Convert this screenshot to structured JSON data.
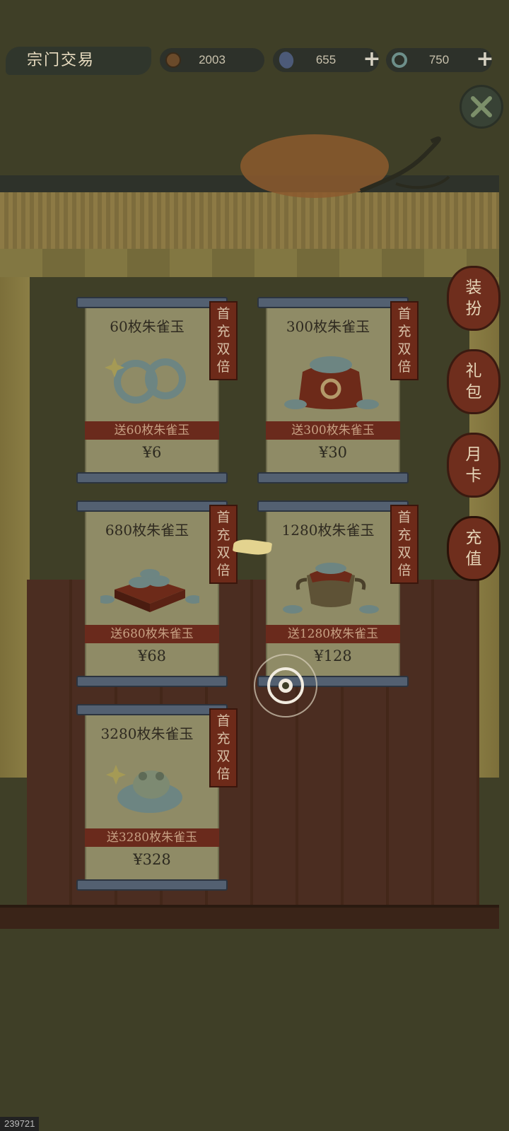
{
  "header": {
    "title": "宗门交易",
    "coins": "2003",
    "gems": "655",
    "jade": "750",
    "plus_symbol": "+"
  },
  "side_tabs": [
    {
      "char1": "装",
      "char2": "扮"
    },
    {
      "char1": "礼",
      "char2": "包"
    },
    {
      "char1": "月",
      "char2": "卡"
    },
    {
      "char1": "充",
      "char2": "值"
    }
  ],
  "packages": [
    {
      "title": "60枚朱雀玉",
      "bonus": "送60枚朱雀玉",
      "price": "¥6",
      "badge": [
        "首",
        "充",
        "双",
        "倍"
      ]
    },
    {
      "title": "300枚朱雀玉",
      "bonus": "送300枚朱雀玉",
      "price": "¥30",
      "badge": [
        "首",
        "充",
        "双",
        "倍"
      ]
    },
    {
      "title": "680枚朱雀玉",
      "bonus": "送680枚朱雀玉",
      "price": "¥68",
      "badge": [
        "首",
        "充",
        "双",
        "倍"
      ]
    },
    {
      "title": "1280枚朱雀玉",
      "bonus": "送1280枚朱雀玉",
      "price": "¥128",
      "badge": [
        "首",
        "充",
        "双",
        "倍"
      ]
    },
    {
      "title": "3280枚朱雀玉",
      "bonus": "送3280枚朱雀玉",
      "price": "¥328",
      "badge": [
        "首",
        "充",
        "双",
        "倍"
      ]
    }
  ],
  "watermark": "239721",
  "colors": {
    "overlay_bg": "#3f3f27",
    "badge_red": "#6d2a19",
    "scroll_paper": "#8f8b66",
    "scroll_rod": "#536071"
  }
}
